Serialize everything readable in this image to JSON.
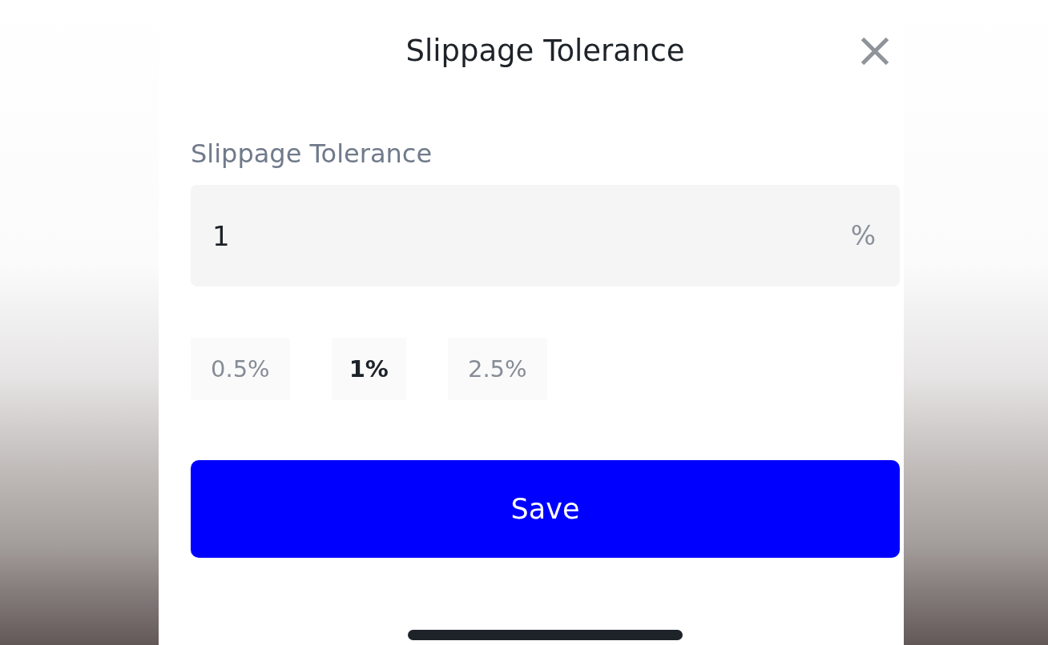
{
  "header": {
    "title": "Slippage Tolerance"
  },
  "field": {
    "label": "Slippage Tolerance",
    "value": "1",
    "suffix": "%"
  },
  "presets": [
    {
      "label": "0.5%",
      "selected": false
    },
    {
      "label": "1%",
      "selected": true
    },
    {
      "label": "2.5%",
      "selected": false
    }
  ],
  "save_button": {
    "label": "Save"
  }
}
